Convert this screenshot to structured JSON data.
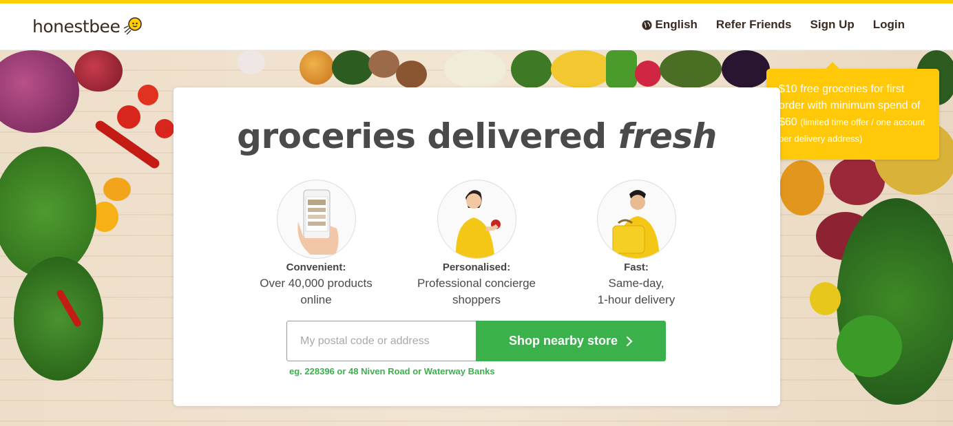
{
  "brand": {
    "name": "honestbee",
    "accent": "#ffcd00",
    "green": "#3ab14a",
    "promo_bg": "#ffc808"
  },
  "nav": {
    "language": "English",
    "refer": "Refer Friends",
    "signup": "Sign Up",
    "login": "Login",
    "language_icon": "globe-icon"
  },
  "hero": {
    "headline_main": "groceries delivered ",
    "headline_emphasis": "fresh"
  },
  "features": [
    {
      "title": "Convenient:",
      "desc": "Over 40,000 products\nonline",
      "image": "phone-app-image"
    },
    {
      "title": "Personalised:",
      "desc": "Professional concierge\nshoppers",
      "image": "concierge-shopper-image"
    },
    {
      "title": "Fast:",
      "desc": "Same-day,\n1-hour delivery",
      "image": "delivery-person-image"
    }
  ],
  "search": {
    "placeholder": "My postal code or address",
    "value": "",
    "button_label": "Shop nearby store",
    "button_icon": "chevron-right-icon",
    "hint": "eg. 228396 or 48 Niven Road or Waterway Banks"
  },
  "promo": {
    "main": "$10 free groceries for first order with minimum spend of $60",
    "fine": "(limited time offer / one account per delivery address)"
  }
}
